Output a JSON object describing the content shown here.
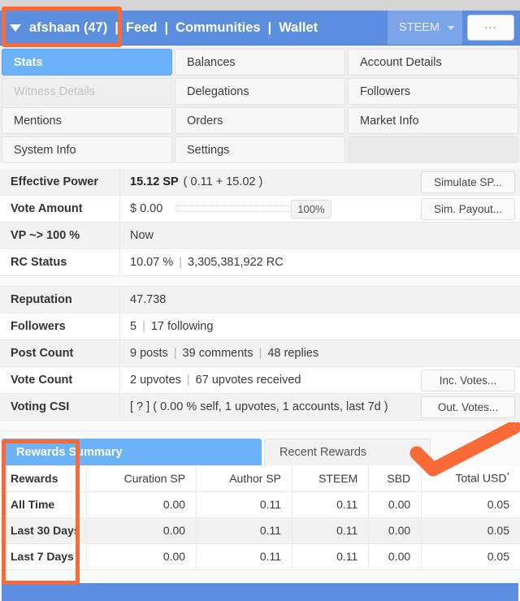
{
  "header": {
    "user": "afshaan (47)",
    "sep": "|",
    "nav": [
      {
        "label": "Feed"
      },
      {
        "label": "Communities"
      },
      {
        "label": "Wallet"
      }
    ],
    "currency_selected": "STEEM",
    "more_label": "..."
  },
  "tabs": [
    {
      "label": "Stats",
      "state": "active"
    },
    {
      "label": "Balances",
      "state": "normal"
    },
    {
      "label": "Account Details",
      "state": "normal"
    },
    {
      "label": "Witness Details",
      "state": "disabled"
    },
    {
      "label": "Delegations",
      "state": "normal"
    },
    {
      "label": "Followers",
      "state": "normal"
    },
    {
      "label": "Mentions",
      "state": "normal"
    },
    {
      "label": "Orders",
      "state": "normal"
    },
    {
      "label": "Market Info",
      "state": "normal"
    },
    {
      "label": "System Info",
      "state": "normal"
    },
    {
      "label": "Settings",
      "state": "normal"
    },
    {
      "label": "",
      "state": "empty"
    }
  ],
  "stats_group_1": [
    {
      "label": "Effective Power",
      "value_strong": "15.12 SP",
      "value_rest": "( 0.11 + 15.02 )",
      "button": "Simulate SP..."
    },
    {
      "label": "Vote Amount",
      "value_strong": "$ 0.00",
      "slider_percent": "100%",
      "button": "Sim. Payout..."
    },
    {
      "label": "VP ~> 100 %",
      "value_strong": "",
      "value_rest": "Now",
      "button": ""
    },
    {
      "label": "RC Status",
      "value_strong": "",
      "value_rest": "10.07 %",
      "value_rest2": "3,305,381,922 RC",
      "button": ""
    }
  ],
  "stats_group_2": [
    {
      "label": "Reputation",
      "value_rest": "47.738",
      "button": ""
    },
    {
      "label": "Followers",
      "value_rest": "5",
      "value_rest2": "17 following",
      "button": ""
    },
    {
      "label": "Post Count",
      "value_rest": "9 posts",
      "value_rest2": "39 comments",
      "value_rest3": "48 replies",
      "button": ""
    },
    {
      "label": "Vote Count",
      "value_rest": "2 upvotes",
      "value_rest2": "67 upvotes received",
      "button": "Inc. Votes..."
    },
    {
      "label": "Voting CSI",
      "value_rest": "[ ? ] ( 0.00 % self, 1 upvotes, 1 accounts, last 7d )",
      "button": "Out. Votes..."
    }
  ],
  "rewards": {
    "tabs": [
      {
        "label": "Rewards Summary",
        "state": "active"
      },
      {
        "label": "Recent Rewards",
        "state": "inactive"
      }
    ],
    "columns": [
      "Rewards",
      "Curation SP",
      "Author SP",
      "STEEM",
      "SBD",
      "Total USD"
    ],
    "total_usd_superscript": "*",
    "rows": [
      {
        "period": "All Time",
        "curation_sp": "0.00",
        "author_sp": "0.11",
        "steem": "0.11",
        "sbd": "0.00",
        "total_usd": "0.05"
      },
      {
        "period": "Last 30 Days",
        "curation_sp": "0.00",
        "author_sp": "0.11",
        "steem": "0.11",
        "sbd": "0.00",
        "total_usd": "0.05"
      },
      {
        "period": "Last 7 Days",
        "curation_sp": "0.00",
        "author_sp": "0.11",
        "steem": "0.11",
        "sbd": "0.00",
        "total_usd": "0.05"
      }
    ]
  },
  "colors": {
    "header_blue": "#5b8ede",
    "active_tab_blue": "#6cb2fa",
    "annotation_orange": "#f96a36"
  }
}
